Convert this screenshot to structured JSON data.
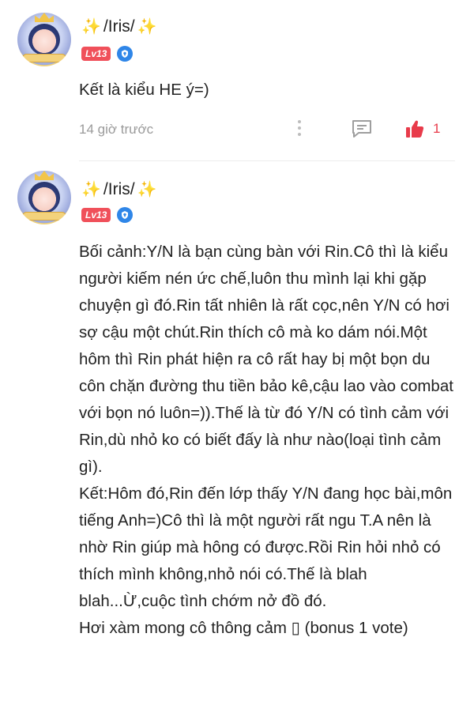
{
  "comments": [
    {
      "username": "/Iris/",
      "sparkle_left": "✨",
      "sparkle_right": "✨",
      "level": "Lv13",
      "text": "Kết là kiểu HE ý=)",
      "time": "14 giờ trước",
      "likes": "1"
    },
    {
      "username": "/Iris/",
      "sparkle_left": "✨",
      "sparkle_right": "✨",
      "level": "Lv13",
      "paragraphs": [
        "Bối cảnh:Y/N là bạn cùng bàn với Rin.Cô thì là kiểu người kiếm nén ức chế,luôn thu mình lại khi gặp chuyện gì đó.Rin tất nhiên là rất cọc,nên Y/N có hơi sợ cậu một chút.Rin thích cô mà ko dám nói.Một hôm thì Rin phát hiện ra cô rất hay bị một bọn du côn chặn đường thu tiền bảo kê,cậu lao vào combat với bọn nó luôn=)).Thế là từ đó Y/N có tình cảm với Rin,dù nhỏ ko có biết đấy là như nào(loại tình cảm gì).",
        "Kết:Hôm đó,Rin đến lớp thấy Y/N đang học bài,môn tiếng Anh=)Cô thì là một người rất ngu T.A nên là nhờ Rin giúp mà hông có được.Rồi Rin hỏi nhỏ có thích mình không,nhỏ nói có.Thế là blah blah...Ừ,cuộc tình chớm nở đồ đó.",
        "Hơi xàm mong cô thông cảm ▯ (bonus 1 vote)"
      ]
    }
  ],
  "icons": {
    "more": "more-vertical-icon",
    "reply": "reply-comment-icon",
    "like": "thumbs-up-icon",
    "badge": "shield-badge-icon"
  },
  "colors": {
    "like_red": "#e83b4a",
    "level_badge": "#f0505a",
    "shield_blue": "#2f86e8",
    "sparkle": "#f5c400",
    "muted": "#9a9a9a"
  }
}
